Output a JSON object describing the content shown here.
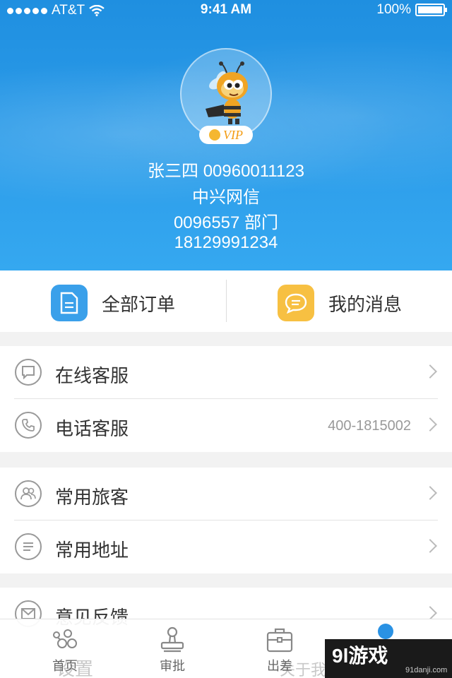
{
  "status_bar": {
    "carrier": "AT&T",
    "time": "9:41 AM",
    "battery": "100%"
  },
  "profile": {
    "vip_badge": "VIP",
    "name_line": "张三四  00960011123",
    "company": "中兴网信",
    "department": "0096557 部门",
    "phone": "18129991234"
  },
  "quick_actions": {
    "orders_label": "全部订单",
    "messages_label": "我的消息"
  },
  "menu": {
    "online_service": "在线客服",
    "phone_service": "电话客服",
    "phone_service_value": "400-1815002",
    "frequent_travelers": "常用旅客",
    "frequent_addresses": "常用地址",
    "feedback": "意见反馈"
  },
  "tabs": {
    "home": "首页",
    "approval": "审批",
    "business_trip": "出差"
  },
  "partially_hidden": {
    "settings": "设置",
    "about": "关于我"
  },
  "watermark": {
    "main": "9l游戏",
    "sub": "91danji.com"
  },
  "colors": {
    "header_blue": "#2a9ae8",
    "orders_icon": "#3aa0ea",
    "messages_icon": "#f7c042",
    "vip_gold": "#f39c12"
  }
}
